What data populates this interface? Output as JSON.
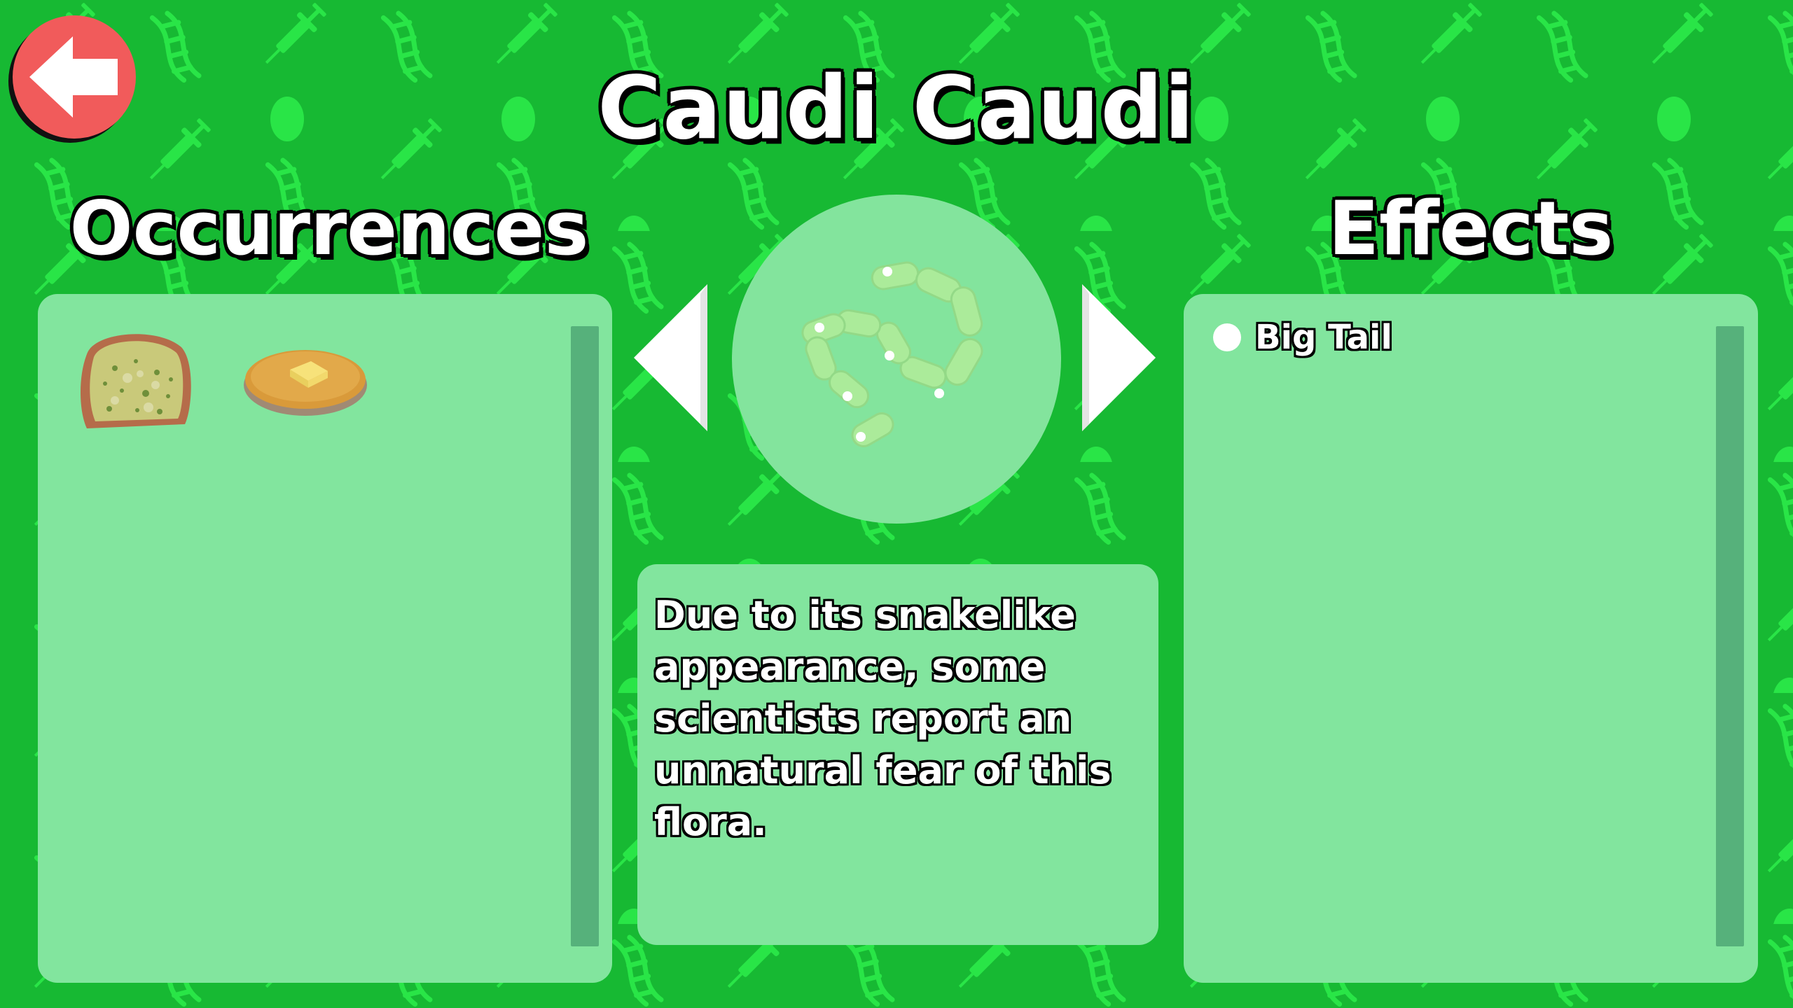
{
  "title": "Caudi Caudi",
  "occurrences": {
    "heading": "Occurrences",
    "items": [
      {
        "icon": "moldy-bread-icon"
      },
      {
        "icon": "pancake-with-butter-icon"
      }
    ]
  },
  "effects": {
    "heading": "Effects",
    "items": [
      {
        "label": "Big Tail"
      }
    ]
  },
  "description": "Due to its snakelike appearance, some scientists report an unnatural fear of this flora.",
  "navigation": {
    "back_icon": "back-arrow-icon",
    "prev_icon": "previous-arrow-icon",
    "next_icon": "next-arrow-icon"
  },
  "colors": {
    "background": "#17b933",
    "pattern": "#29e547",
    "panel": "#82e59e",
    "scrollbar": "#56b17b",
    "back_button": "#f15b5b"
  }
}
